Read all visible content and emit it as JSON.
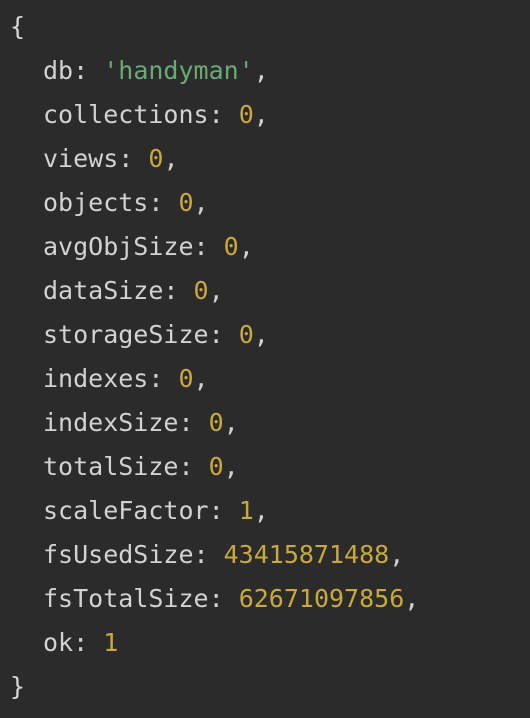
{
  "output": {
    "open_brace": "{",
    "close_brace": "}",
    "fields": [
      {
        "key": "db",
        "value": "'handyman'",
        "type": "string",
        "comma": ","
      },
      {
        "key": "collections",
        "value": "0",
        "type": "number",
        "comma": ","
      },
      {
        "key": "views",
        "value": "0",
        "type": "number",
        "comma": ","
      },
      {
        "key": "objects",
        "value": "0",
        "type": "number",
        "comma": ","
      },
      {
        "key": "avgObjSize",
        "value": "0",
        "type": "number",
        "comma": ","
      },
      {
        "key": "dataSize",
        "value": "0",
        "type": "number",
        "comma": ","
      },
      {
        "key": "storageSize",
        "value": "0",
        "type": "number",
        "comma": ","
      },
      {
        "key": "indexes",
        "value": "0",
        "type": "number",
        "comma": ","
      },
      {
        "key": "indexSize",
        "value": "0",
        "type": "number",
        "comma": ","
      },
      {
        "key": "totalSize",
        "value": "0",
        "type": "number",
        "comma": ","
      },
      {
        "key": "scaleFactor",
        "value": "1",
        "type": "number",
        "comma": ","
      },
      {
        "key": "fsUsedSize",
        "value": "43415871488",
        "type": "number",
        "comma": ","
      },
      {
        "key": "fsTotalSize",
        "value": "62671097856",
        "type": "number",
        "comma": ","
      },
      {
        "key": "ok",
        "value": "1",
        "type": "number",
        "comma": ""
      }
    ]
  },
  "colors": {
    "background": "#2b2b2b",
    "key": "#d2d2d2",
    "string": "#6aab73",
    "number": "#c9a93e"
  }
}
